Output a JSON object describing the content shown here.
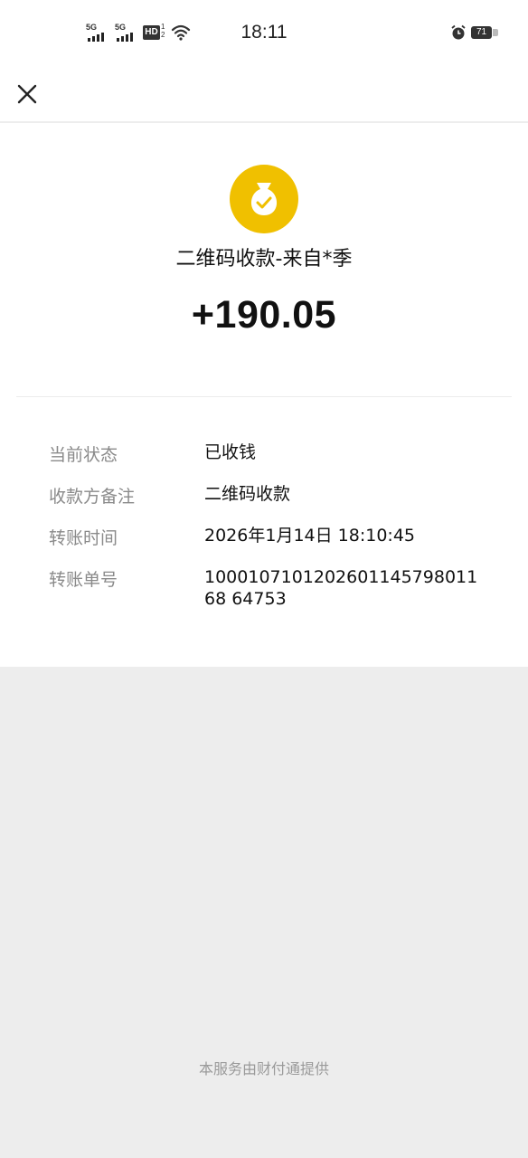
{
  "status_bar": {
    "signal1_label": "5G",
    "signal2_label": "5G",
    "hd_label": "HD",
    "hd_superscript": "1",
    "hd_subscript": "2",
    "time": "18:11",
    "battery_level": "71",
    "icons": [
      "signal-icon",
      "signal-icon",
      "hd-icon",
      "wifi-icon",
      "alarm-icon",
      "battery-icon"
    ]
  },
  "nav": {
    "close_icon": "close-icon"
  },
  "header": {
    "icon": "money-bag-check-icon",
    "icon_color": "#f0c000",
    "title": "二维码收款-来自*季",
    "amount": "+190.05"
  },
  "details": [
    {
      "key": "当前状态",
      "value": "已收钱"
    },
    {
      "key": "收款方备注",
      "value": "二维码收款"
    },
    {
      "key": "转账时间",
      "value": "2026年1月14日 18:10:45"
    },
    {
      "key": "转账单号",
      "value": "100010710120260114579801168 64753"
    }
  ],
  "footer": {
    "text": "本服务由财付通提供"
  }
}
